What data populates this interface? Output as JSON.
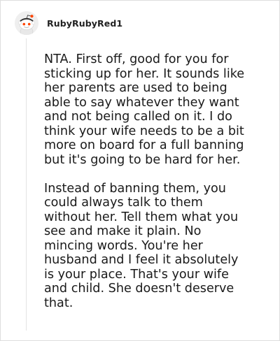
{
  "comment": {
    "username": "RubyRubyRed1",
    "avatar_icon": "snoo-avatar-icon",
    "paragraphs": [
      "NTA. First off, good for you for\nsticking up for her. It sounds like\nher parents are used to being\nable to say whatever they want\nand not being called on it. I do\nthink your wife needs to be a bit\nmore on board for a full banning\nbut it's going to be hard for her.",
      "Instead of banning them, you\ncould always talk to them\nwithout her. Tell them what you\nsee and make it plain. No\nmincing words. You're her\nhusband and I feel it absolutely\nis your place. That's your wife\nand child. She doesn't deserve\nthat."
    ]
  },
  "colors": {
    "accent": "#ff4500",
    "border": "#dedede",
    "thread_line": "#e3e3e3",
    "text": "#1a1a1a"
  }
}
